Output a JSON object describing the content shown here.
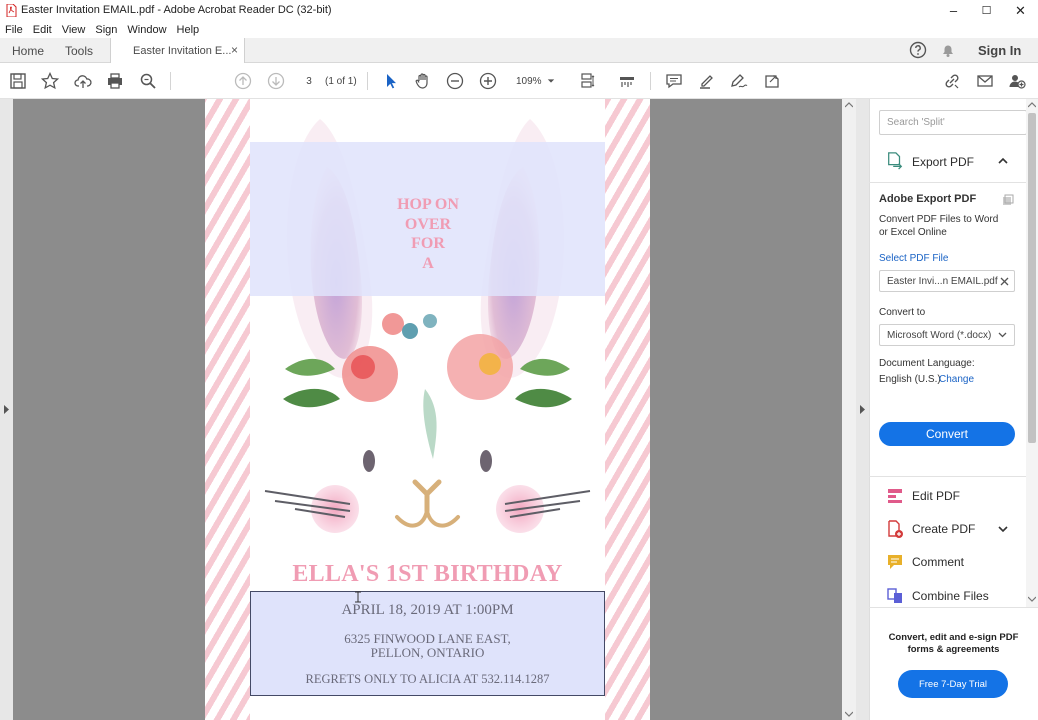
{
  "window": {
    "title": "Easter Invitation EMAIL.pdf - Adobe Acrobat Reader DC (32-bit)",
    "min": "–",
    "max": "☐",
    "close": "✕"
  },
  "menu": [
    "File",
    "Edit",
    "View",
    "Sign",
    "Window",
    "Help"
  ],
  "tabs": {
    "home": "Home",
    "tools": "Tools",
    "document": "Easter Invitation E...",
    "close": "×",
    "sign_in": "Sign In"
  },
  "toolbar": {
    "page_number": "3",
    "page_count": "(1 of 1)",
    "zoom": "109%"
  },
  "document": {
    "top_text_lines": [
      "HOP ON",
      "OVER",
      "FOR",
      "A"
    ],
    "headline": "ELLA'S 1ST BIRTHDAY",
    "date": "APRIL 18, 2019 AT 1:00PM",
    "address1": "6325 FINWOOD LANE EAST,",
    "address2": "PELLON, ONTARIO",
    "regrets": "REGRETS ONLY TO ALICIA AT 532.114.1287"
  },
  "panel": {
    "search_placeholder": "Search 'Split'",
    "export_title": "Export PDF",
    "adobe_export_title": "Adobe Export PDF",
    "adobe_export_desc1": "Convert PDF Files to Word",
    "adobe_export_desc2": "or Excel Online",
    "select_pdf_label": "Select PDF File",
    "selected_file": "Easter Invi...n EMAIL.pdf",
    "convert_to_label": "Convert to",
    "convert_to_value": "Microsoft Word (*.docx)",
    "doc_language_label": "Document Language:",
    "doc_language_value": "English (U.S.)",
    "change_link": "Change",
    "convert_button": "Convert",
    "tools": [
      "Edit PDF",
      "Create PDF",
      "Comment",
      "Combine Files"
    ],
    "promo_line1": "Convert, edit and e-sign PDF",
    "promo_line2": "forms & agreements",
    "trial_button": "Free 7-Day Trial"
  },
  "colors": {
    "accent_blue": "#1473e6",
    "link_blue": "#1a63c5",
    "headline_pink": "#f09cb3",
    "overlay_blue": "#dfe3fb"
  }
}
